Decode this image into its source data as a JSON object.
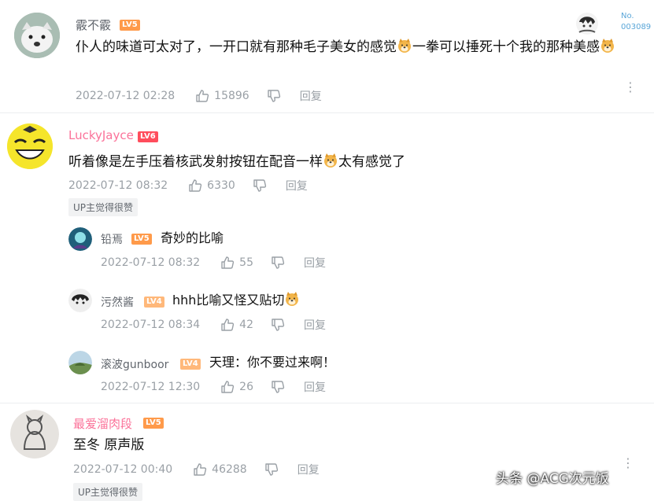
{
  "badge_up": "UP主觉得很赞",
  "reply_label": "回复",
  "corner_no": {
    "label": "No.",
    "number": "003089"
  },
  "watermark": "头条 @ACG次元饭",
  "comments": [
    {
      "user": "霰不霰",
      "level": "LV5",
      "text_a": "仆人的味道可太对了，一开口就有那种毛子美女的感觉",
      "text_b": "一拳可以捶死十个我的那种美感",
      "time": "2022-07-12 02:28",
      "likes": "15896"
    },
    {
      "user": "LuckyJayce",
      "level": "LV6",
      "text_a": "听着像是左手压着核武发射按钮在配音一样",
      "text_b": "太有感觉了",
      "time": "2022-07-12 08:32",
      "likes": "6330"
    },
    {
      "user": "铅焉",
      "level": "LV5",
      "text": "奇妙的比喻",
      "time": "2022-07-12 08:32",
      "likes": "55"
    },
    {
      "user": "污然酱",
      "level": "LV4",
      "text": "hhh比喻又怪又贴切",
      "time": "2022-07-12 08:34",
      "likes": "42"
    },
    {
      "user": "滚波gunboor",
      "level": "LV4",
      "text": "天理：你不要过来啊！",
      "time": "2022-07-12 12:30",
      "likes": "26"
    },
    {
      "user": "最爱溜肉段",
      "level": "LV5",
      "text": "至冬 原声版",
      "time": "2022-07-12 00:40",
      "likes": "46288"
    }
  ]
}
